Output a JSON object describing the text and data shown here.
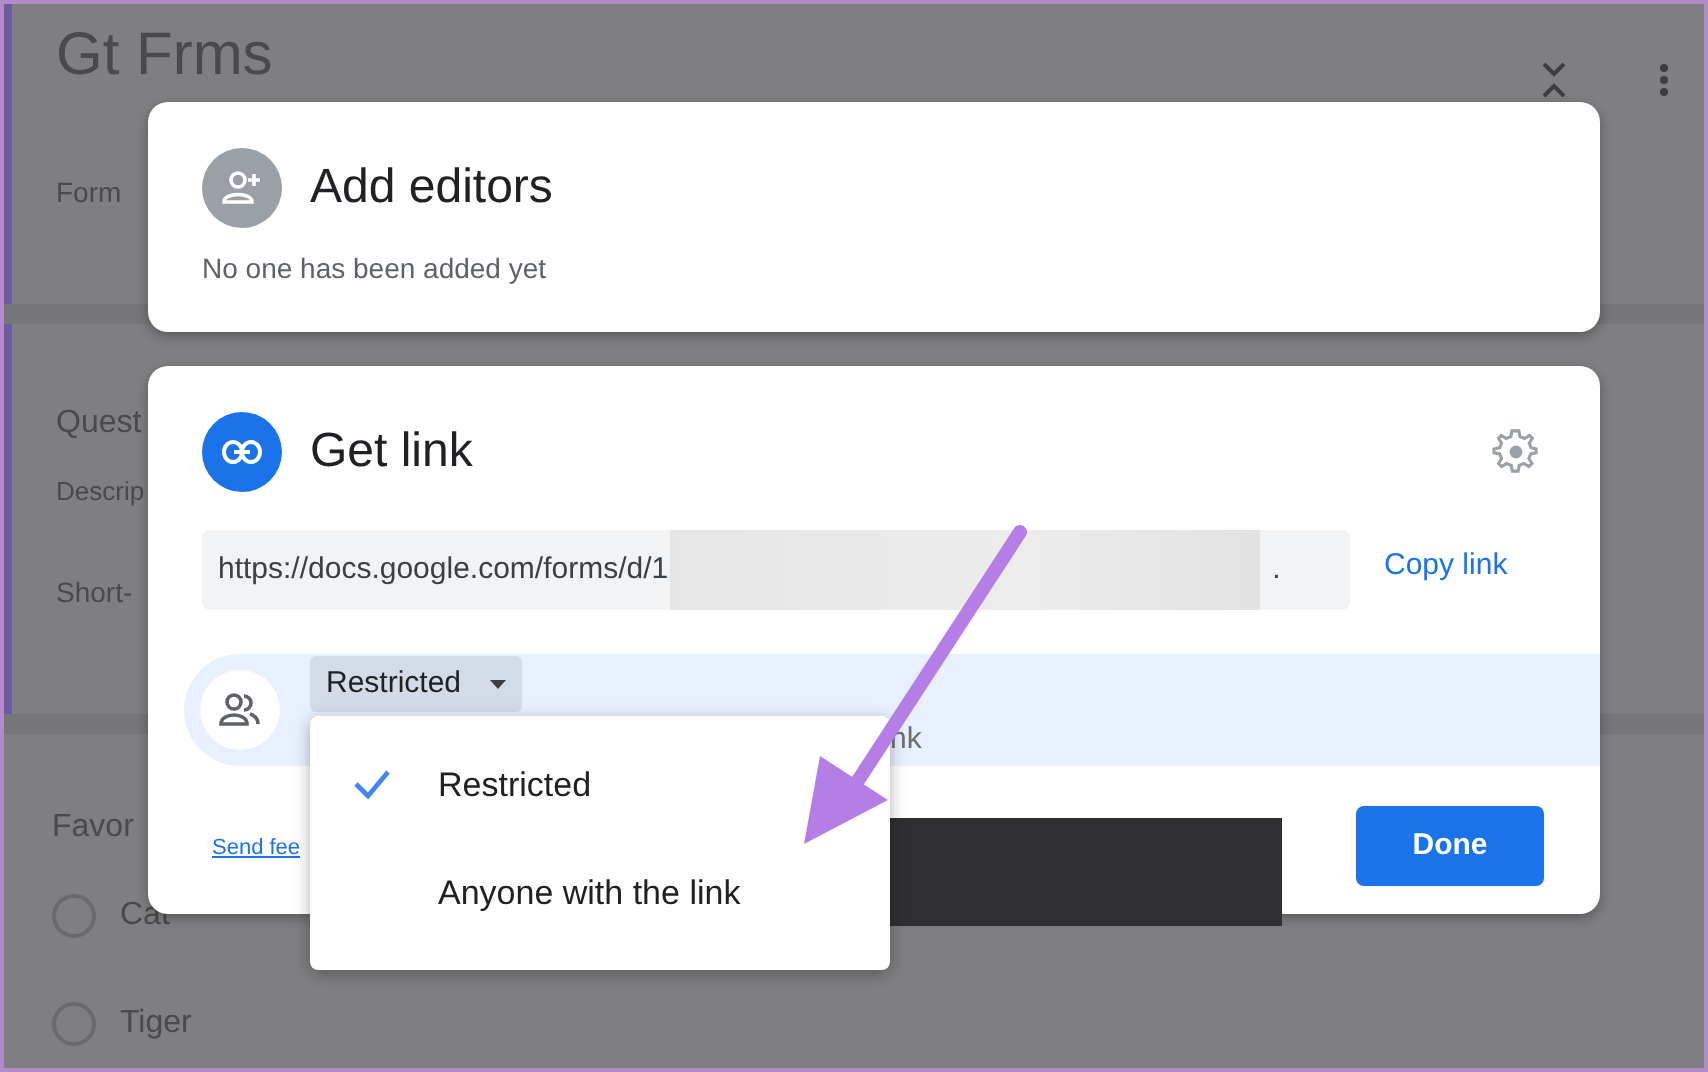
{
  "background_form": {
    "title": "Gt Frms",
    "description": "Form",
    "question": "Quest",
    "question_description": "Descrip",
    "answer_hint": "Short-",
    "question_2": "Favor",
    "options": [
      {
        "label": "Cat",
        "selected": false
      },
      {
        "label": "Tiger",
        "selected": false
      }
    ]
  },
  "add_editors": {
    "title": "Add editors",
    "message": "No one has been added yet"
  },
  "get_link": {
    "title": "Get link",
    "url": "https://docs.google.com/forms/d/1",
    "url_end": ".",
    "copy_button": "Copy link",
    "access": {
      "label": "Restricted",
      "hint_fragment": "nk"
    },
    "feedback_link": "Send fee",
    "done_button": "Done"
  },
  "access_menu": [
    {
      "label": "Restricted",
      "selected": true
    },
    {
      "label": "Anyone with the link",
      "selected": false
    }
  ]
}
